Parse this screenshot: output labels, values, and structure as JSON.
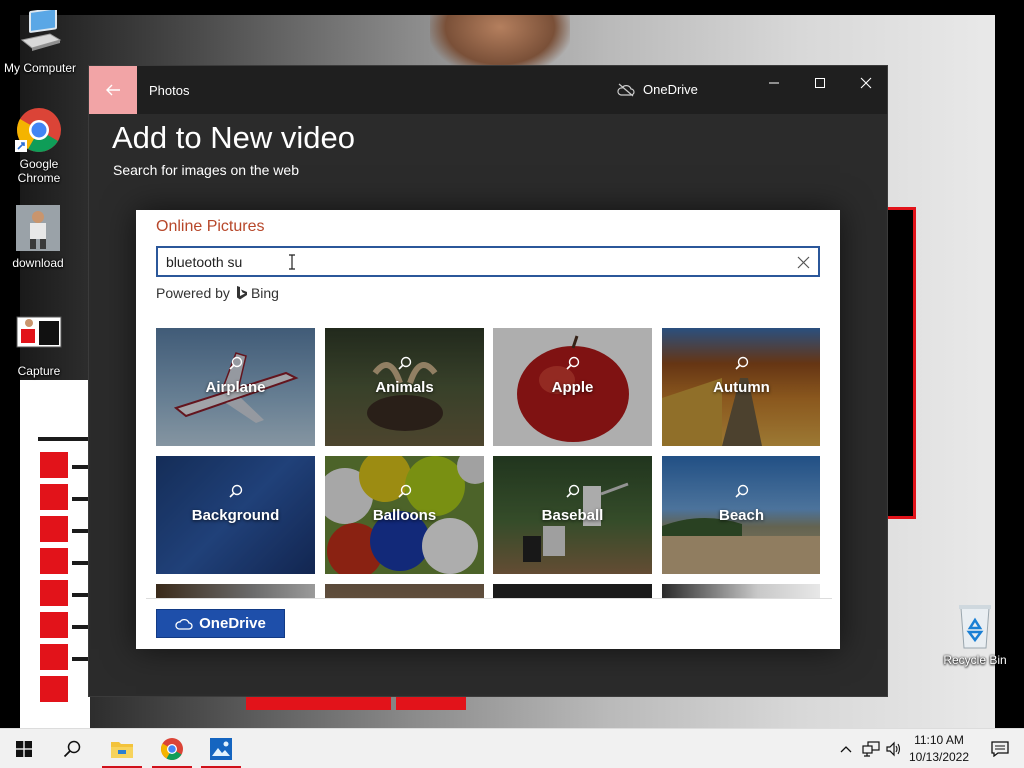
{
  "desktop": {
    "icons": [
      {
        "label": "My Computer"
      },
      {
        "label": "Google Chrome"
      },
      {
        "label": "download"
      },
      {
        "label": "Capture"
      },
      {
        "label": "Recycle Bin"
      }
    ]
  },
  "window": {
    "app_name": "Photos",
    "onedrive_label": "OneDrive",
    "page_title": "Add to New video",
    "page_subtitle": "Search for images on the web",
    "accent_back": "#f2a4a6"
  },
  "dialog": {
    "title": "Online Pictures",
    "search_value": "bluetooth su",
    "powered_by": "Powered by",
    "bing_label": "Bing",
    "onedrive_button": "OneDrive",
    "tiles": [
      {
        "label": "Airplane"
      },
      {
        "label": "Animals"
      },
      {
        "label": "Apple"
      },
      {
        "label": "Autumn"
      },
      {
        "label": "Background"
      },
      {
        "label": "Balloons"
      },
      {
        "label": "Baseball"
      },
      {
        "label": "Beach"
      }
    ]
  },
  "taskbar": {
    "time": "11:10 AM",
    "date": "10/13/2022"
  }
}
